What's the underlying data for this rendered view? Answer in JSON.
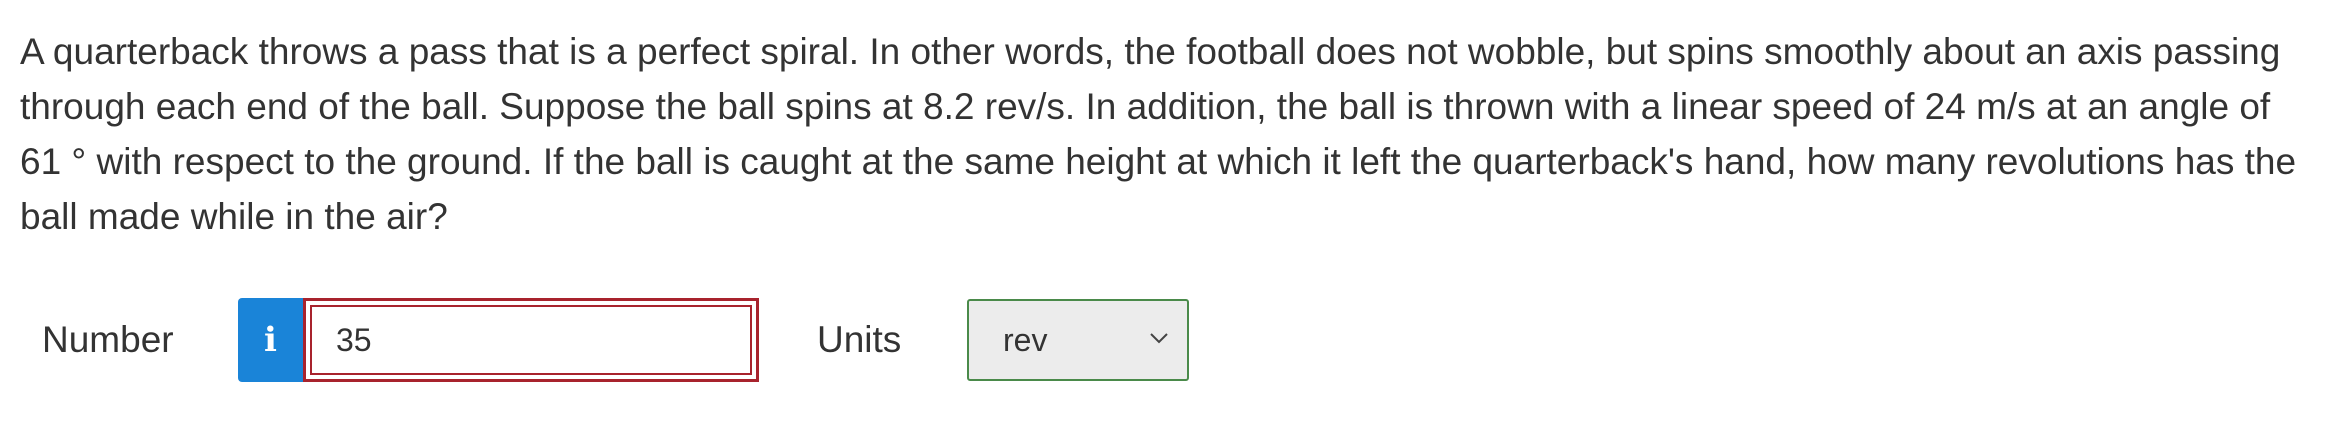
{
  "question": {
    "text": "A quarterback throws a pass that is a perfect spiral. In other words, the football does not wobble, but spins smoothly about an axis passing through each end of the ball. Suppose the ball spins at 8.2 rev/s. In addition, the ball is thrown with a linear speed of 24 m/s at an angle of 61 ° with respect to the ground. If the ball is caught at the same height at which it left the quarterback's hand, how many revolutions has the ball made while in the air?"
  },
  "answer": {
    "number_label": "Number",
    "info_icon": "info-icon",
    "info_glyph": "i",
    "number_value": "35",
    "units_label": "Units",
    "units_selected": "rev",
    "chevron_icon": "chevron-down-icon"
  },
  "colors": {
    "info_button": "#1a84d8",
    "input_border": "#a8232d",
    "select_border": "#4a8a4a",
    "select_background": "#ececec",
    "text": "#333333"
  }
}
